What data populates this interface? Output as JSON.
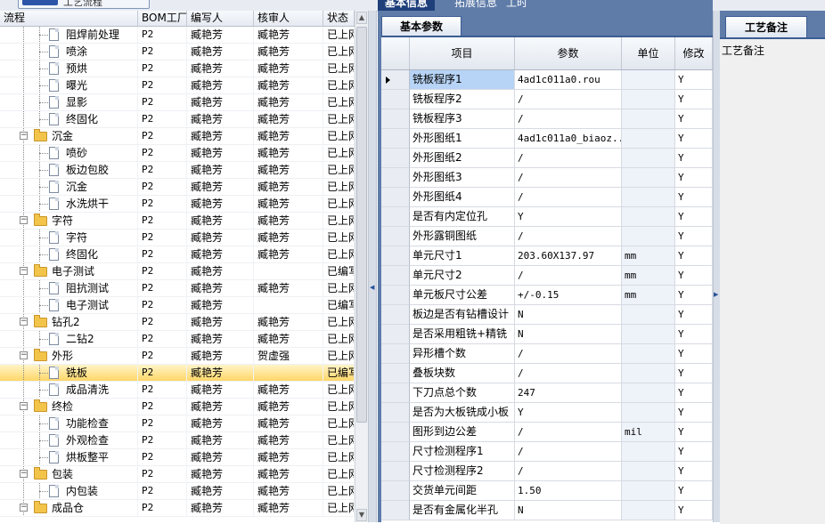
{
  "top_button": {
    "label": "工艺流程"
  },
  "left_grid": {
    "columns": [
      "流程",
      "BOM工厂",
      "编写人",
      "核审人",
      "状态"
    ],
    "rows": [
      {
        "label": "阻焊前处理",
        "type": "doc",
        "level": 2,
        "bom": "P2",
        "writer": "臧艳芳",
        "reviewer": "臧艳芳",
        "status": "已上网"
      },
      {
        "label": "喷涂",
        "type": "doc",
        "level": 2,
        "bom": "P2",
        "writer": "臧艳芳",
        "reviewer": "臧艳芳",
        "status": "已上网"
      },
      {
        "label": "预烘",
        "type": "doc",
        "level": 2,
        "bom": "P2",
        "writer": "臧艳芳",
        "reviewer": "臧艳芳",
        "status": "已上网"
      },
      {
        "label": "曝光",
        "type": "doc",
        "level": 2,
        "bom": "P2",
        "writer": "臧艳芳",
        "reviewer": "臧艳芳",
        "status": "已上网"
      },
      {
        "label": "显影",
        "type": "doc",
        "level": 2,
        "bom": "P2",
        "writer": "臧艳芳",
        "reviewer": "臧艳芳",
        "status": "已上网"
      },
      {
        "label": "终固化",
        "type": "doc",
        "level": 2,
        "bom": "P2",
        "writer": "臧艳芳",
        "reviewer": "臧艳芳",
        "status": "已上网"
      },
      {
        "label": "沉金",
        "type": "folder",
        "level": 1,
        "bom": "P2",
        "writer": "臧艳芳",
        "reviewer": "臧艳芳",
        "status": "已上网"
      },
      {
        "label": "喷砂",
        "type": "doc",
        "level": 2,
        "bom": "P2",
        "writer": "臧艳芳",
        "reviewer": "臧艳芳",
        "status": "已上网"
      },
      {
        "label": "板边包胶",
        "type": "doc",
        "level": 2,
        "bom": "P2",
        "writer": "臧艳芳",
        "reviewer": "臧艳芳",
        "status": "已上网"
      },
      {
        "label": "沉金",
        "type": "doc",
        "level": 2,
        "bom": "P2",
        "writer": "臧艳芳",
        "reviewer": "臧艳芳",
        "status": "已上网"
      },
      {
        "label": "水洗烘干",
        "type": "doc",
        "level": 2,
        "bom": "P2",
        "writer": "臧艳芳",
        "reviewer": "臧艳芳",
        "status": "已上网"
      },
      {
        "label": "字符",
        "type": "folder",
        "level": 1,
        "bom": "P2",
        "writer": "臧艳芳",
        "reviewer": "臧艳芳",
        "status": "已上网"
      },
      {
        "label": "字符",
        "type": "doc",
        "level": 2,
        "bom": "P2",
        "writer": "臧艳芳",
        "reviewer": "臧艳芳",
        "status": "已上网"
      },
      {
        "label": "终固化",
        "type": "doc",
        "level": 2,
        "bom": "P2",
        "writer": "臧艳芳",
        "reviewer": "臧艳芳",
        "status": "已上网"
      },
      {
        "label": "电子测试",
        "type": "folder",
        "level": 1,
        "bom": "P2",
        "writer": "臧艳芳",
        "reviewer": "",
        "status": "已编写"
      },
      {
        "label": "阻抗测试",
        "type": "doc",
        "level": 2,
        "bom": "P2",
        "writer": "臧艳芳",
        "reviewer": "臧艳芳",
        "status": "已上网"
      },
      {
        "label": "电子测试",
        "type": "doc",
        "level": 2,
        "bom": "P2",
        "writer": "臧艳芳",
        "reviewer": "",
        "status": "已编写"
      },
      {
        "label": "钻孔2",
        "type": "folder",
        "level": 1,
        "bom": "P2",
        "writer": "臧艳芳",
        "reviewer": "臧艳芳",
        "status": "已上网"
      },
      {
        "label": "二钻2",
        "type": "doc",
        "level": 2,
        "bom": "P2",
        "writer": "臧艳芳",
        "reviewer": "臧艳芳",
        "status": "已上网"
      },
      {
        "label": "外形",
        "type": "folder",
        "level": 1,
        "bom": "P2",
        "writer": "臧艳芳",
        "reviewer": "贺虚强",
        "status": "已上网"
      },
      {
        "label": "铣板",
        "type": "doc",
        "level": 2,
        "bom": "P2",
        "writer": "臧艳芳",
        "reviewer": "",
        "status": "已编写",
        "selected": true
      },
      {
        "label": "成品清洗",
        "type": "doc",
        "level": 2,
        "bom": "P2",
        "writer": "臧艳芳",
        "reviewer": "臧艳芳",
        "status": "已上网"
      },
      {
        "label": "终检",
        "type": "folder",
        "level": 1,
        "bom": "P2",
        "writer": "臧艳芳",
        "reviewer": "臧艳芳",
        "status": "已上网"
      },
      {
        "label": "功能检查",
        "type": "doc",
        "level": 2,
        "bom": "P2",
        "writer": "臧艳芳",
        "reviewer": "臧艳芳",
        "status": "已上网"
      },
      {
        "label": "外观检查",
        "type": "doc",
        "level": 2,
        "bom": "P2",
        "writer": "臧艳芳",
        "reviewer": "臧艳芳",
        "status": "已上网"
      },
      {
        "label": "烘板整平",
        "type": "doc",
        "level": 2,
        "bom": "P2",
        "writer": "臧艳芳",
        "reviewer": "臧艳芳",
        "status": "已上网"
      },
      {
        "label": "包装",
        "type": "folder",
        "level": 1,
        "bom": "P2",
        "writer": "臧艳芳",
        "reviewer": "臧艳芳",
        "status": "已上网"
      },
      {
        "label": "内包装",
        "type": "doc",
        "level": 2,
        "bom": "P2",
        "writer": "臧艳芳",
        "reviewer": "臧艳芳",
        "status": "已上网"
      },
      {
        "label": "成品仓",
        "type": "folder",
        "level": 1,
        "bom": "P2",
        "writer": "臧艳芳",
        "reviewer": "臧艳芳",
        "status": "已上网"
      }
    ]
  },
  "right_panel": {
    "top_tabs": [
      "基本信息",
      "拓展信息",
      "工时"
    ],
    "subtab": "基本参数",
    "columns": [
      "项目",
      "参数",
      "单位",
      "修改"
    ],
    "rows": [
      {
        "item": "铣板程序1",
        "param": "4ad1c011a0.rou",
        "unit": "",
        "mod": "Y"
      },
      {
        "item": "铣板程序2",
        "param": "/",
        "unit": "",
        "mod": "Y"
      },
      {
        "item": "铣板程序3",
        "param": "/",
        "unit": "",
        "mod": "Y"
      },
      {
        "item": "外形图纸1",
        "param": "4ad1c011a0_biaoz...",
        "unit": "",
        "mod": "Y"
      },
      {
        "item": "外形图纸2",
        "param": "/",
        "unit": "",
        "mod": "Y"
      },
      {
        "item": "外形图纸3",
        "param": "/",
        "unit": "",
        "mod": "Y"
      },
      {
        "item": "外形图纸4",
        "param": "/",
        "unit": "",
        "mod": "Y"
      },
      {
        "item": "是否有内定位孔",
        "param": "Y",
        "unit": "",
        "mod": "Y"
      },
      {
        "item": "外形露铜图纸",
        "param": "/",
        "unit": "",
        "mod": "Y"
      },
      {
        "item": "单元尺寸1",
        "param": "203.60X137.97",
        "unit": "mm",
        "mod": "Y"
      },
      {
        "item": "单元尺寸2",
        "param": "/",
        "unit": "mm",
        "mod": "Y"
      },
      {
        "item": "单元板尺寸公差",
        "param": "+/-0.15",
        "unit": "mm",
        "mod": "Y"
      },
      {
        "item": "板边是否有钻槽设计",
        "param": "N",
        "unit": "",
        "mod": "Y"
      },
      {
        "item": "是否采用粗铣+精铣",
        "param": "N",
        "unit": "",
        "mod": "Y"
      },
      {
        "item": "异形槽个数",
        "param": "/",
        "unit": "",
        "mod": "Y"
      },
      {
        "item": "叠板块数",
        "param": "/",
        "unit": "",
        "mod": "Y"
      },
      {
        "item": "下刀点总个数",
        "param": "247",
        "unit": "",
        "mod": "Y"
      },
      {
        "item": "是否为大板铣成小板",
        "param": "Y",
        "unit": "",
        "mod": "Y"
      },
      {
        "item": "图形到边公差",
        "param": "/",
        "unit": "mil",
        "mod": "Y"
      },
      {
        "item": "尺寸检测程序1",
        "param": "/",
        "unit": "",
        "mod": "Y"
      },
      {
        "item": "尺寸检测程序2",
        "param": "/",
        "unit": "",
        "mod": "Y"
      },
      {
        "item": "交货单元间距",
        "param": "1.50",
        "unit": "",
        "mod": "Y"
      },
      {
        "item": "是否有金属化半孔",
        "param": "N",
        "unit": "",
        "mod": "Y"
      }
    ]
  },
  "notes_panel": {
    "tab": "工艺备注",
    "label": "工艺备注"
  }
}
